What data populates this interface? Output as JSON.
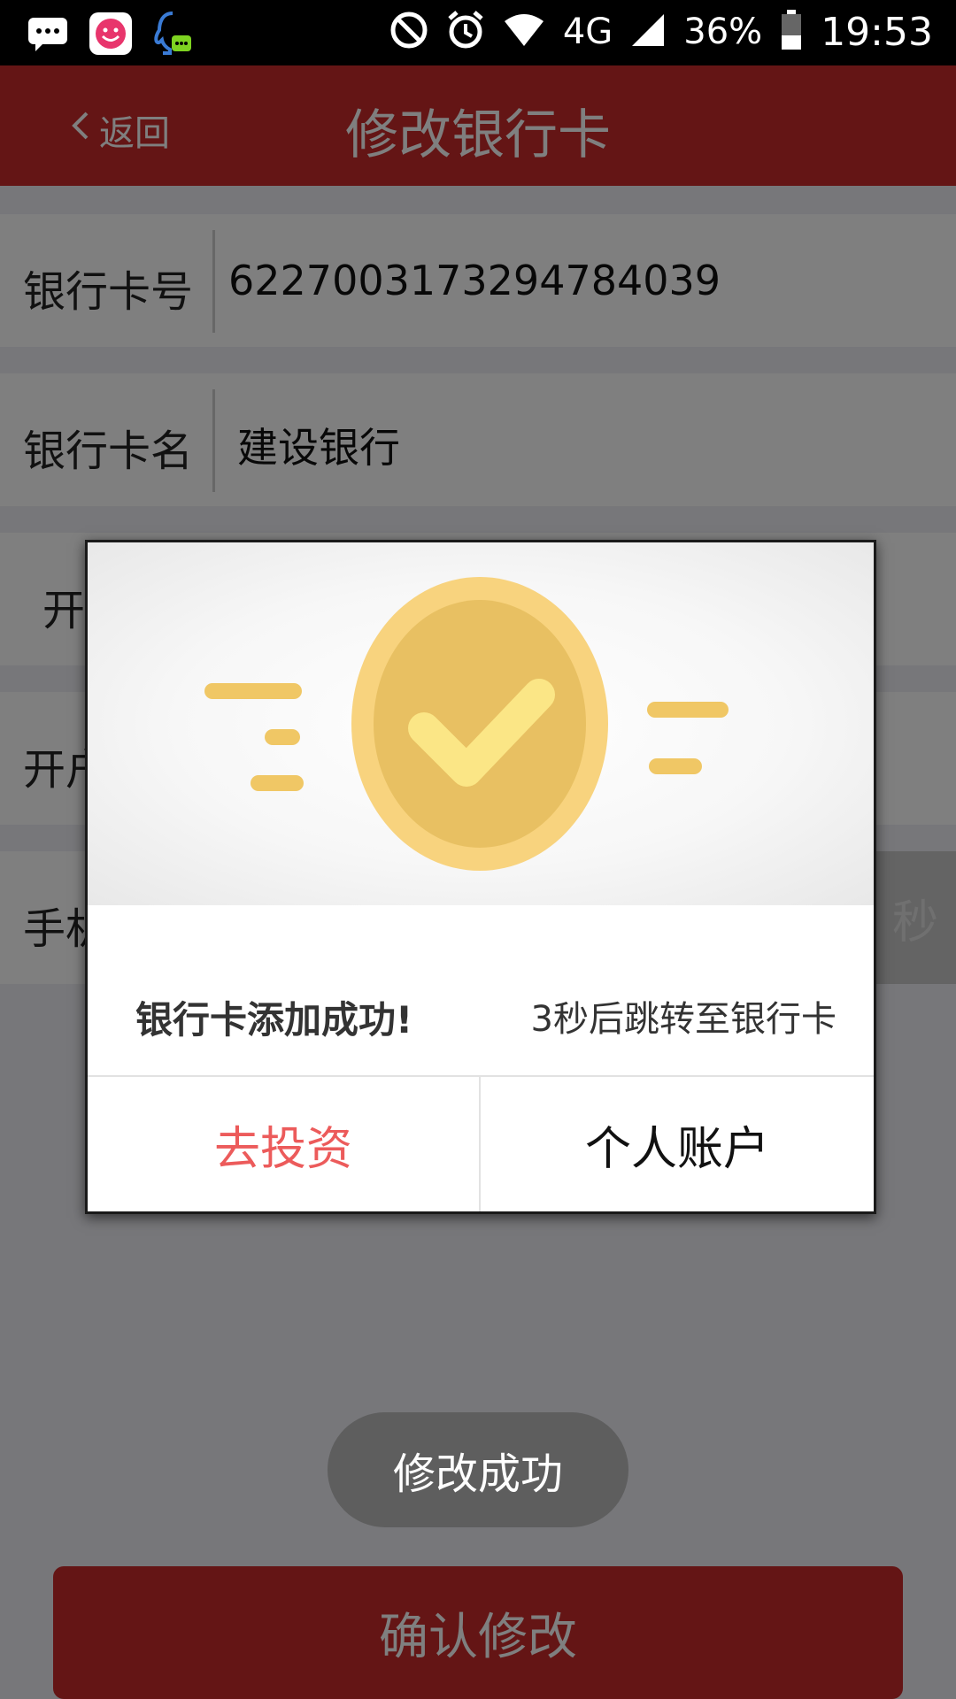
{
  "status_bar": {
    "network": "4G",
    "battery": "36%",
    "time": "19:53",
    "icons": [
      "message-icon",
      "smile-app-icon",
      "qq-chat-icon",
      "do-not-disturb-icon",
      "alarm-icon",
      "wifi-icon",
      "cellular-signal-icon",
      "battery-icon"
    ]
  },
  "header": {
    "back_label": "返回",
    "title": "修改银行卡",
    "color": "#c82b2b"
  },
  "form": {
    "rows": [
      {
        "label": "银行卡号",
        "value": "6227003173294784039"
      },
      {
        "label": "银行卡名",
        "value": "建设银行"
      },
      {
        "label": "开",
        "value": ""
      },
      {
        "label": "开户",
        "value": ""
      },
      {
        "label": "手机",
        "value": "",
        "right_text": "秒"
      }
    ]
  },
  "dialog": {
    "message": "银行卡添加成功!",
    "redirect_hint": "3秒后跳转至银行卡",
    "buttons": {
      "invest": "去投资",
      "account": "个人账户"
    },
    "icon": "check-coin-icon",
    "accent_color": "#f2c24f"
  },
  "toast": {
    "text": "修改成功"
  },
  "footer": {
    "confirm_label": "确认修改"
  }
}
